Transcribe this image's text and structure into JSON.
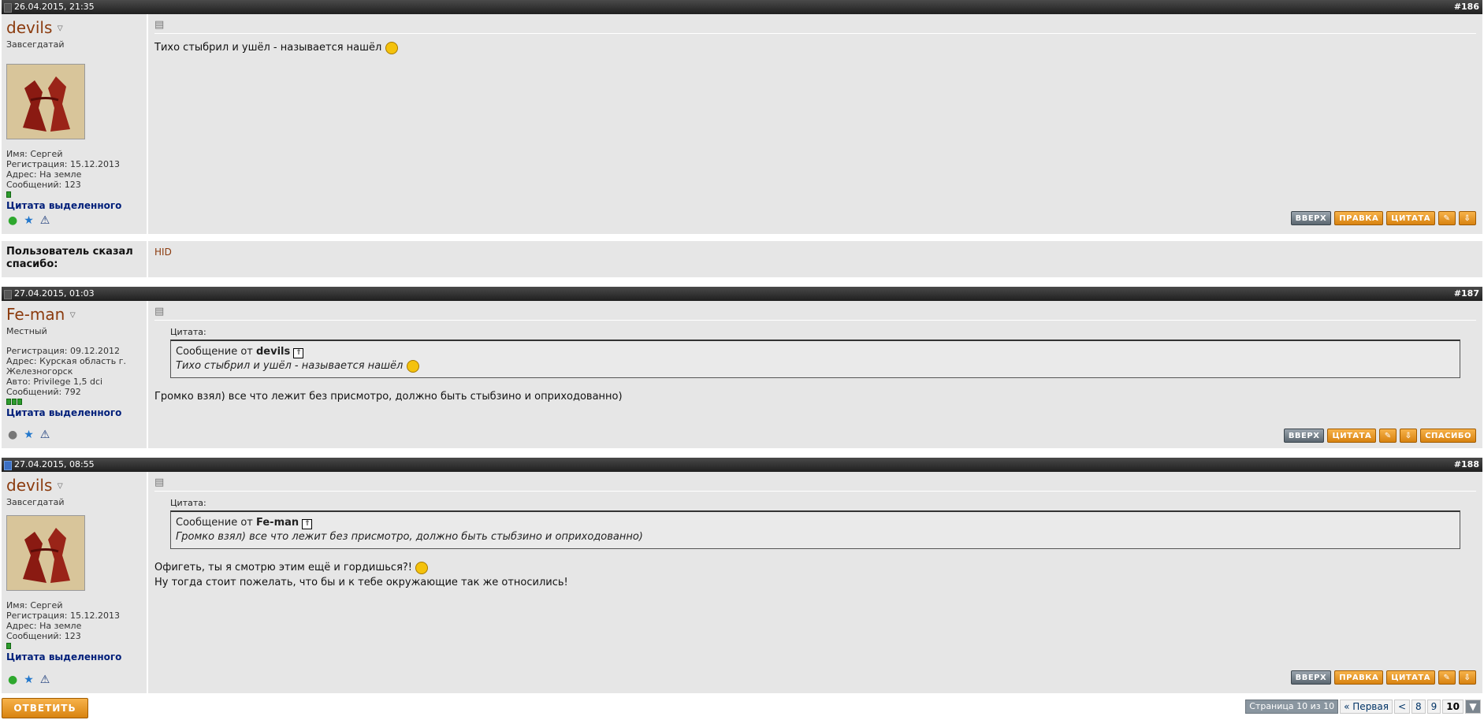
{
  "posts": [
    {
      "date": "26.04.2015, 21:35",
      "number": "#186",
      "username": "devils",
      "user_title": "Завсегдатай",
      "meta": [
        "Имя: Сергей",
        "Регистрация: 15.12.2013",
        "Адрес: На земле",
        "Сообщений: 123"
      ],
      "quote_selected": "Цитата выделенного",
      "message_lines": [
        "Тихо стыбрил и ушёл - называется нашёл"
      ]
    },
    {
      "date": "27.04.2015, 01:03",
      "number": "#187",
      "username": "Fe-man",
      "user_title": "Местный",
      "meta": [
        "Регистрация: 09.12.2012",
        "Адрес: Курская область г. Железногорск",
        "Авто: Privilege 1,5 dci",
        "Сообщений: 792"
      ],
      "quote_selected": "Цитата выделенного",
      "quote": {
        "label": "Цитата:",
        "from_prefix": "Сообщение от",
        "author": "devils",
        "text": "Тихо стыбрил и ушёл - называется нашёл"
      },
      "message_lines": [
        "Громко взял) все что лежит без присмотро, должно быть стыбзино и оприходованно)"
      ]
    },
    {
      "date": "27.04.2015, 08:55",
      "number": "#188",
      "username": "devils",
      "user_title": "Завсегдатай",
      "meta": [
        "Имя: Сергей",
        "Регистрация: 15.12.2013",
        "Адрес: На земле",
        "Сообщений: 123"
      ],
      "quote_selected": "Цитата выделенного",
      "quote": {
        "label": "Цитата:",
        "from_prefix": "Сообщение от",
        "author": "Fe-man",
        "text": "Громко взял) все что лежит без присмотро, должно быть стыбзино и оприходованно)"
      },
      "message_lines": [
        "Офигеть, ты я смотрю этим ещё и гордишься?!",
        "Ну тогда стоит пожелать, что бы и к тебе окружающие так же относились!"
      ]
    }
  ],
  "thanks": {
    "label": "Пользователь сказал спасибо:",
    "users": "HID"
  },
  "buttons": {
    "up": "ВВЕРХ",
    "edit": "ПРАВКА",
    "quote": "ЦИТАТА",
    "thanks": "СПАСИБО"
  },
  "reply_button": "ОТВЕТИТЬ",
  "pager": {
    "info": "Страница 10 из 10",
    "first": "« Первая",
    "prev": "<",
    "pages": [
      "8",
      "9"
    ],
    "current": "10"
  },
  "colors": {
    "header_bg": "#2d2d2d",
    "post_bg": "#e6e6e6",
    "button_orange": "#e8951f",
    "username": "#8b3b0e"
  }
}
